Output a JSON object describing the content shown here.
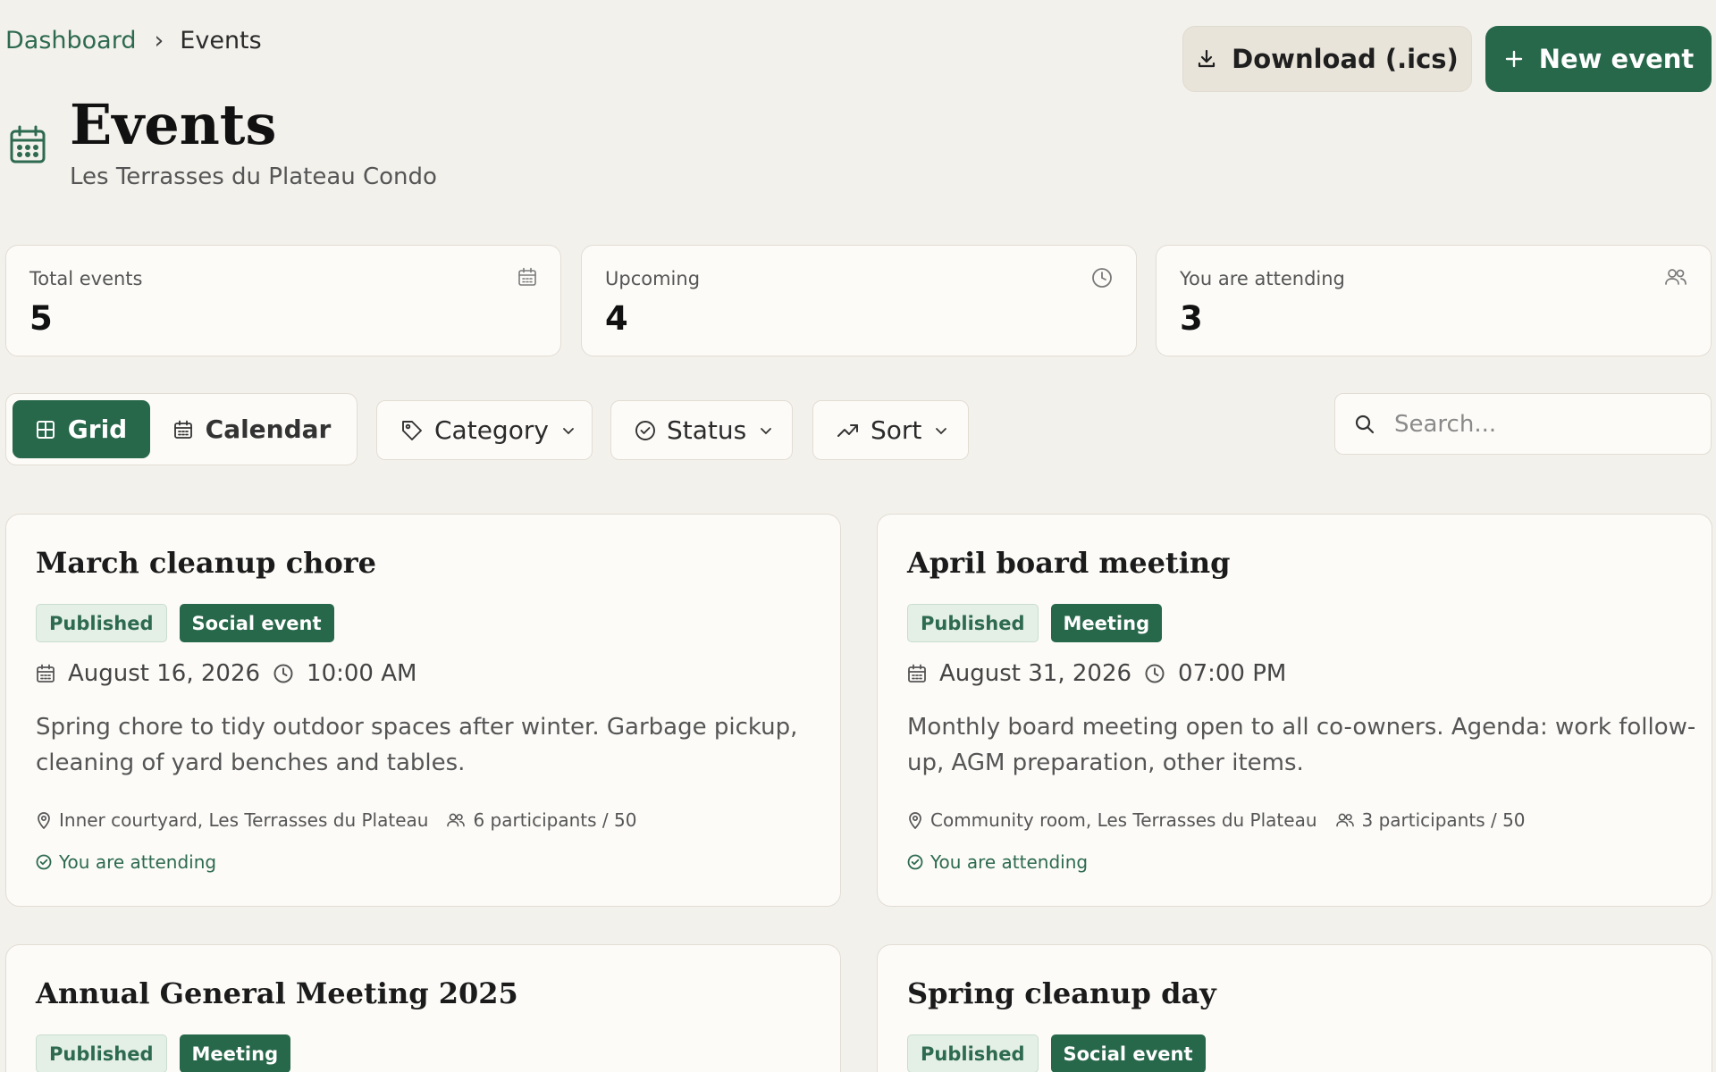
{
  "breadcrumb": {
    "parent": "Dashboard",
    "separator": "›",
    "current": "Events"
  },
  "actions": {
    "download_label": "Download (.ics)",
    "new_label": "New event"
  },
  "header": {
    "title": "Events",
    "subtitle": "Les Terrasses du Plateau Condo",
    "icon": "calendar-icon"
  },
  "stats": [
    {
      "label": "Total events",
      "value": "5",
      "icon": "calendar-icon"
    },
    {
      "label": "Upcoming",
      "value": "4",
      "icon": "clock-icon"
    },
    {
      "label": "You are attending",
      "value": "3",
      "icon": "users-icon"
    }
  ],
  "view_toggle": {
    "grid_label": "Grid",
    "calendar_label": "Calendar",
    "selected": "Grid"
  },
  "filters": {
    "category_label": "Category",
    "status_label": "Status",
    "sort_label": "Sort"
  },
  "search": {
    "placeholder": "Search...",
    "value": ""
  },
  "events": [
    {
      "title": "March cleanup chore",
      "status": "Published",
      "category": "Social event",
      "date": "August 16, 2026",
      "time": "10:00 AM",
      "description": "Spring chore to tidy outdoor spaces after winter. Garbage pickup, cleaning of yard benches and tables.",
      "location": "Inner courtyard, Les Terrasses du Plateau",
      "participants": "6 participants / 50",
      "attending_label": "You are attending"
    },
    {
      "title": "April board meeting",
      "status": "Published",
      "category": "Meeting",
      "date": "August 31, 2026",
      "time": "07:00 PM",
      "description": "Monthly board meeting open to all co-owners. Agenda: work follow-up, AGM preparation, other items.",
      "location": "Community room, Les Terrasses du Plateau",
      "participants": "3 participants / 50",
      "attending_label": "You are attending"
    },
    {
      "title": "Annual General Meeting 2025",
      "status": "Published",
      "category": "Meeting"
    },
    {
      "title": "Spring cleanup day",
      "status": "Published",
      "category": "Social event"
    }
  ],
  "colors": {
    "accent": "#27674a",
    "background": "#f3f1ec",
    "card": "#fcfbf8",
    "border": "#e2ddd3"
  }
}
